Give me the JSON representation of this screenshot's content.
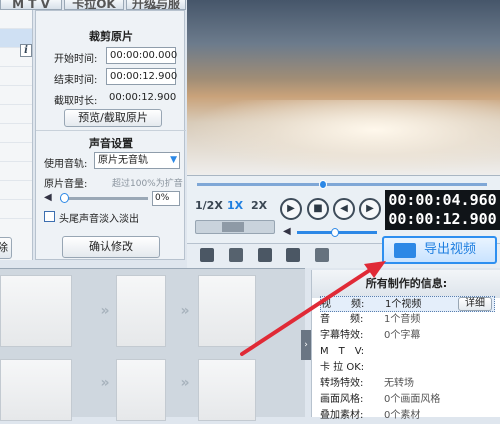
{
  "tabs": [
    "M T V",
    "卡拉OK",
    "升级与服务"
  ],
  "crop": {
    "title": "裁剪原片",
    "start_label": "开始时间:",
    "start_value": "00:00:00.000",
    "end_label": "结束时间:",
    "end_value": "00:00:12.900",
    "duration_label": "截取时长:",
    "duration_value": "00:00:12.900",
    "preview_button": "预览/截取原片"
  },
  "audio": {
    "title": "声音设置",
    "track_label": "使用音轨:",
    "track_value": "原片无音轨",
    "volume_label": "原片音量:",
    "volume_hint": "超过100%为扩音",
    "volume_value": "0%",
    "fade_label": "头尾声音淡入淡出",
    "confirm_button": "确认修改"
  },
  "left": {
    "info_icon": "i",
    "delete_label": "除"
  },
  "player": {
    "speeds": [
      "1/2X",
      "1X",
      "2X"
    ],
    "active_speed": "1X",
    "current_time": "00:00:04.960",
    "total_time": "00:00:12.900",
    "progress": 0.39
  },
  "export_button": "导出视频",
  "info": {
    "title": "所有制作的信息:",
    "detail_button": "详细",
    "rows": [
      {
        "k": "视　　频:",
        "v": "1个视频"
      },
      {
        "k": "音　　频:",
        "v": "1个音频"
      },
      {
        "k": "字幕特效:",
        "v": "0个字幕"
      },
      {
        "k": "M　T　V:",
        "v": ""
      },
      {
        "k": "卡 拉 OK:",
        "v": ""
      },
      {
        "k": "转场特效:",
        "v": "无转场"
      },
      {
        "k": "画面风格:",
        "v": "0个画面风格"
      },
      {
        "k": "叠加素材:",
        "v": "0个素材"
      }
    ]
  },
  "colors": {
    "accent": "#2d8ff0",
    "annotation": "#e02a36"
  }
}
